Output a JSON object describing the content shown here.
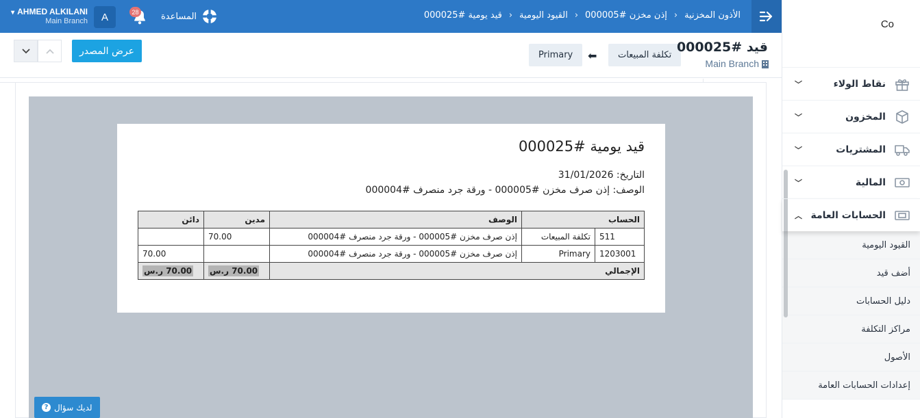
{
  "topbar": {
    "user_name": "AHMED ALKILANI",
    "user_branch": "Main Branch",
    "avatar_letter": "A",
    "notifications_count": "28",
    "help_label": "المساعدة",
    "breadcrumbs": [
      "الأذون المخزنية",
      "إذن مخزن #000005",
      "القيود اليومية",
      "قيد يومية #000025"
    ]
  },
  "subbar": {
    "view_source_label": "عرض المصدر",
    "tag_primary": "Primary",
    "tag_cogs": "تكلفة المبيعات",
    "doc_title": "قيد #000025",
    "doc_branch": "Main Branch"
  },
  "document": {
    "title": "قيد يومية #000025",
    "date_line": "التاريخ: 31/01/2026",
    "description_line": "الوصف: إذن صرف مخزن #000005 - ورقة جرد منصرف #000004",
    "headers": {
      "account": "الحساب",
      "description": "الوصف",
      "debit": "مدين",
      "credit": "دائن"
    },
    "rows": [
      {
        "code": "511",
        "account": "تكلفة المبيعات",
        "description": "إذن صرف مخزن #000005 - ورقة جرد منصرف #000004",
        "debit": "70.00",
        "credit": ""
      },
      {
        "code": "1203001",
        "account": "Primary",
        "description": "إذن صرف مخزن #000005 - ورقة جرد منصرف #000004",
        "debit": "",
        "credit": "70.00"
      }
    ],
    "total_label": "الإجمالي",
    "total_debit": "70.00 ر.س",
    "total_credit": "70.00 ر.س"
  },
  "help_button": "لديك سؤال",
  "sidebar": {
    "company": "Co",
    "items": [
      {
        "label": "نقاط الولاء",
        "icon": "gift-icon",
        "expanded": false
      },
      {
        "label": "المخزون",
        "icon": "box-icon",
        "expanded": false
      },
      {
        "label": "المشتريات",
        "icon": "truck-icon",
        "expanded": false
      },
      {
        "label": "المالية",
        "icon": "money-icon",
        "expanded": false
      },
      {
        "label": "الحسابات العامة",
        "icon": "ledger-icon",
        "expanded": true
      }
    ],
    "subitems": [
      "القيود اليومية",
      "أضف قيد",
      "دليل الحسابات",
      "مراكز التكلفة",
      "الأصول",
      "إعدادات الحسابات العامة"
    ]
  }
}
